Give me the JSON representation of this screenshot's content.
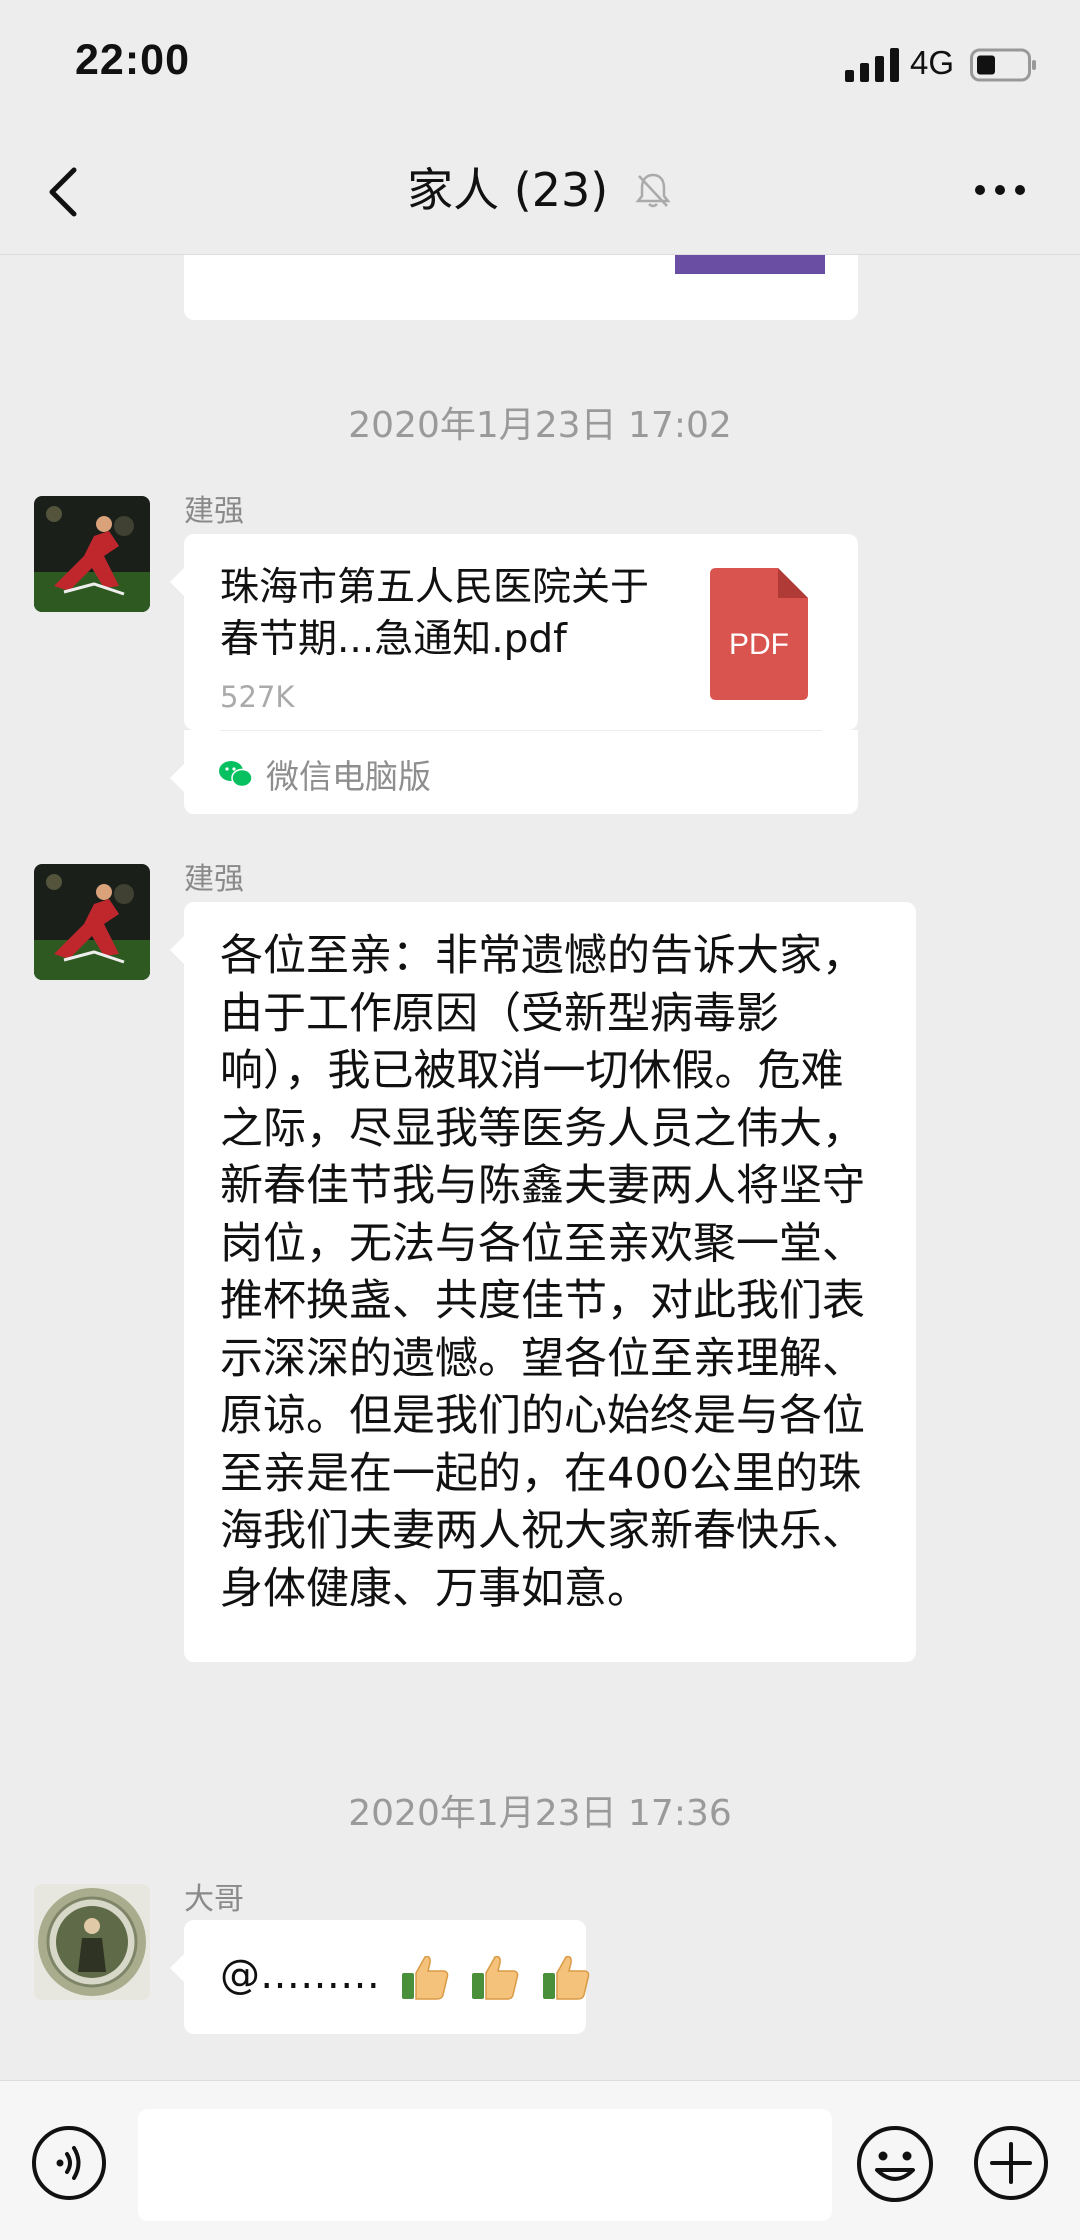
{
  "status_bar": {
    "time": "22:00",
    "network": "4G"
  },
  "nav": {
    "title": "家人 (23)",
    "back_icon": "chevron-left-icon",
    "mute_icon": "bell-off-icon",
    "more_icon": "more-dots-icon"
  },
  "messages": {
    "timestamp_1": "2020年1月23日 17:02",
    "file_msg": {
      "sender": "建强",
      "file_name": "珠海市第五人民医院关于春节期...急通知.pdf",
      "file_size": "527K",
      "file_type": "PDF",
      "source": "微信电脑版"
    },
    "text_msg": {
      "sender": "建强",
      "text": "各位至亲：非常遗憾的告诉大家，由于工作原因（受新型病毒影响），我已被取消一切休假。危难之际，尽显我等医务人员之伟大，新春佳节我与陈鑫夫妻两人将坚守岗位，无法与各位至亲欢聚一堂、推杯换盏、共度佳节，对此我们表示深深的遗憾。望各位至亲理解、原谅。但是我们的心始终是与各位至亲是在一起的，在400公里的珠海我们夫妻两人祝大家新春快乐、身体健康、万事如意。"
    },
    "timestamp_2": "2020年1月23日 17:36",
    "reply_msg": {
      "sender": "大哥",
      "text": "@………",
      "emoji": [
        "thumbs-up",
        "thumbs-up",
        "thumbs-up"
      ]
    }
  },
  "input_bar": {
    "voice_icon": "voice-icon",
    "emoji_icon": "emoji-icon",
    "plus_icon": "plus-icon",
    "placeholder": ""
  },
  "colors": {
    "background": "#ededed",
    "pdf_red": "#d9534f",
    "purple_thumb": "#6a4ea4",
    "wechat_green": "#07c160"
  }
}
